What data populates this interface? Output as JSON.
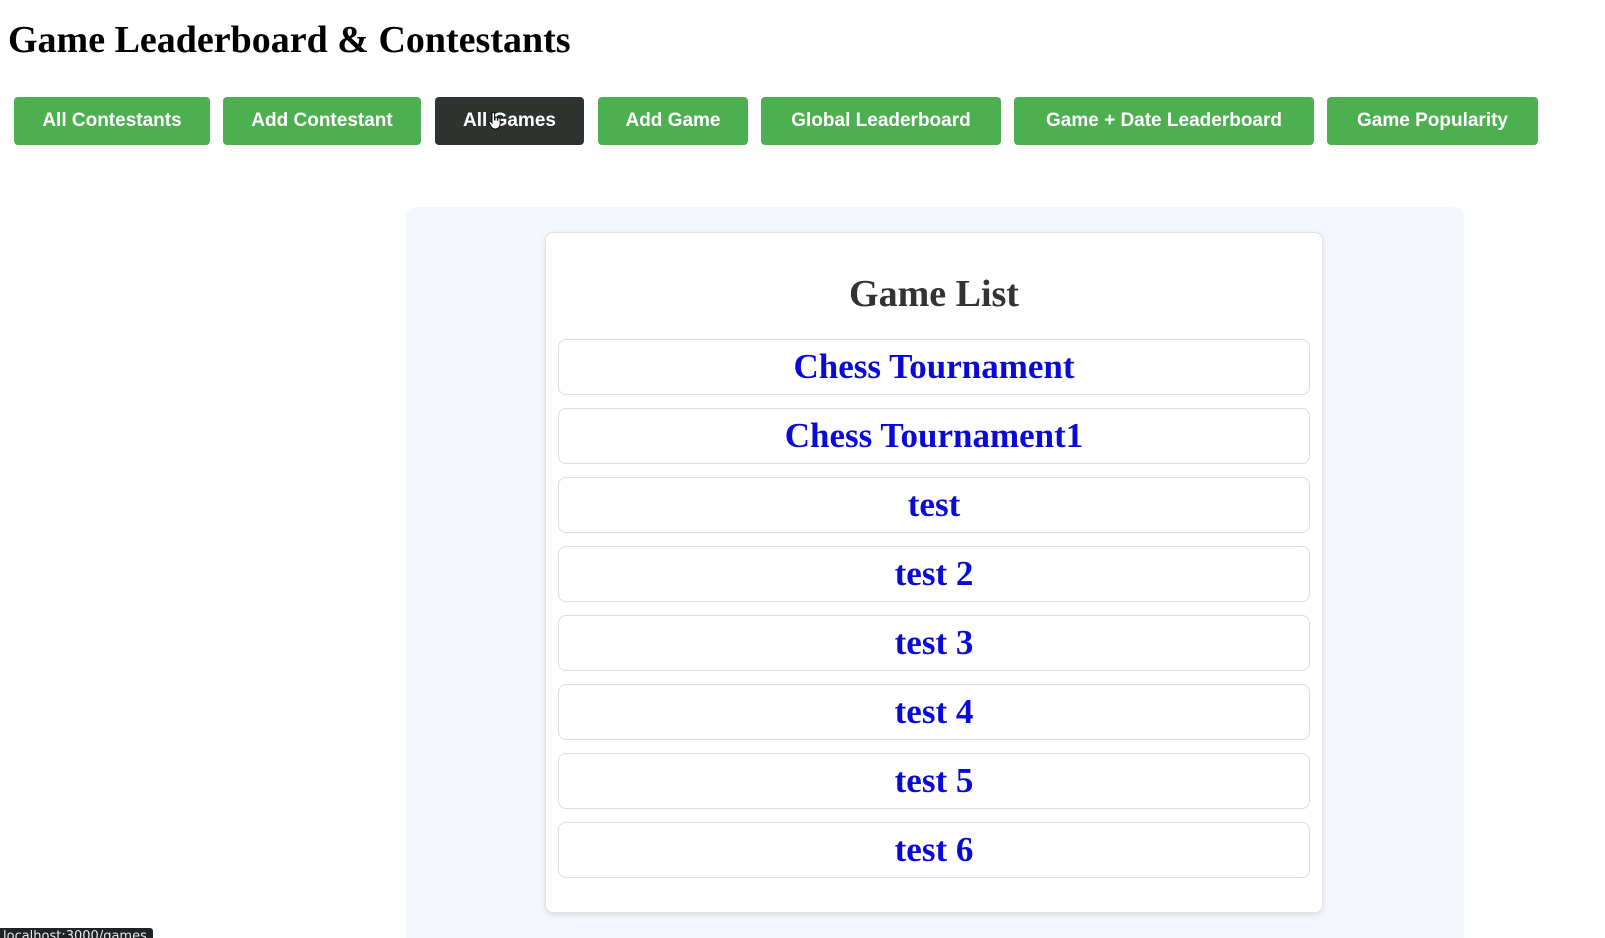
{
  "page": {
    "title": "Game Leaderboard & Contestants"
  },
  "nav": {
    "items": [
      {
        "label": "All Contestants",
        "active": false
      },
      {
        "label": "Add Contestant",
        "active": false
      },
      {
        "label": "All Games",
        "active": true
      },
      {
        "label": "Add Game",
        "active": false
      },
      {
        "label": "Global Leaderboard",
        "active": false
      },
      {
        "label": "Game + Date Leaderboard",
        "active": false
      },
      {
        "label": "Game Popularity",
        "active": false
      }
    ]
  },
  "games": {
    "title": "Game List",
    "items": [
      {
        "name": "Chess Tournament"
      },
      {
        "name": "Chess Tournament1"
      },
      {
        "name": "test"
      },
      {
        "name": "test 2"
      },
      {
        "name": "test 3"
      },
      {
        "name": "test 4"
      },
      {
        "name": "test 5"
      },
      {
        "name": "test 6"
      }
    ]
  },
  "status_bar": {
    "url": "localhost:3000/games"
  },
  "colors": {
    "nav_button": "#4caf50",
    "nav_button_active": "#2f3330",
    "game_link": "#0a0ad6",
    "panel_background": "#f4f7fb"
  },
  "icons": {
    "cursor": "hand-pointer-icon"
  }
}
